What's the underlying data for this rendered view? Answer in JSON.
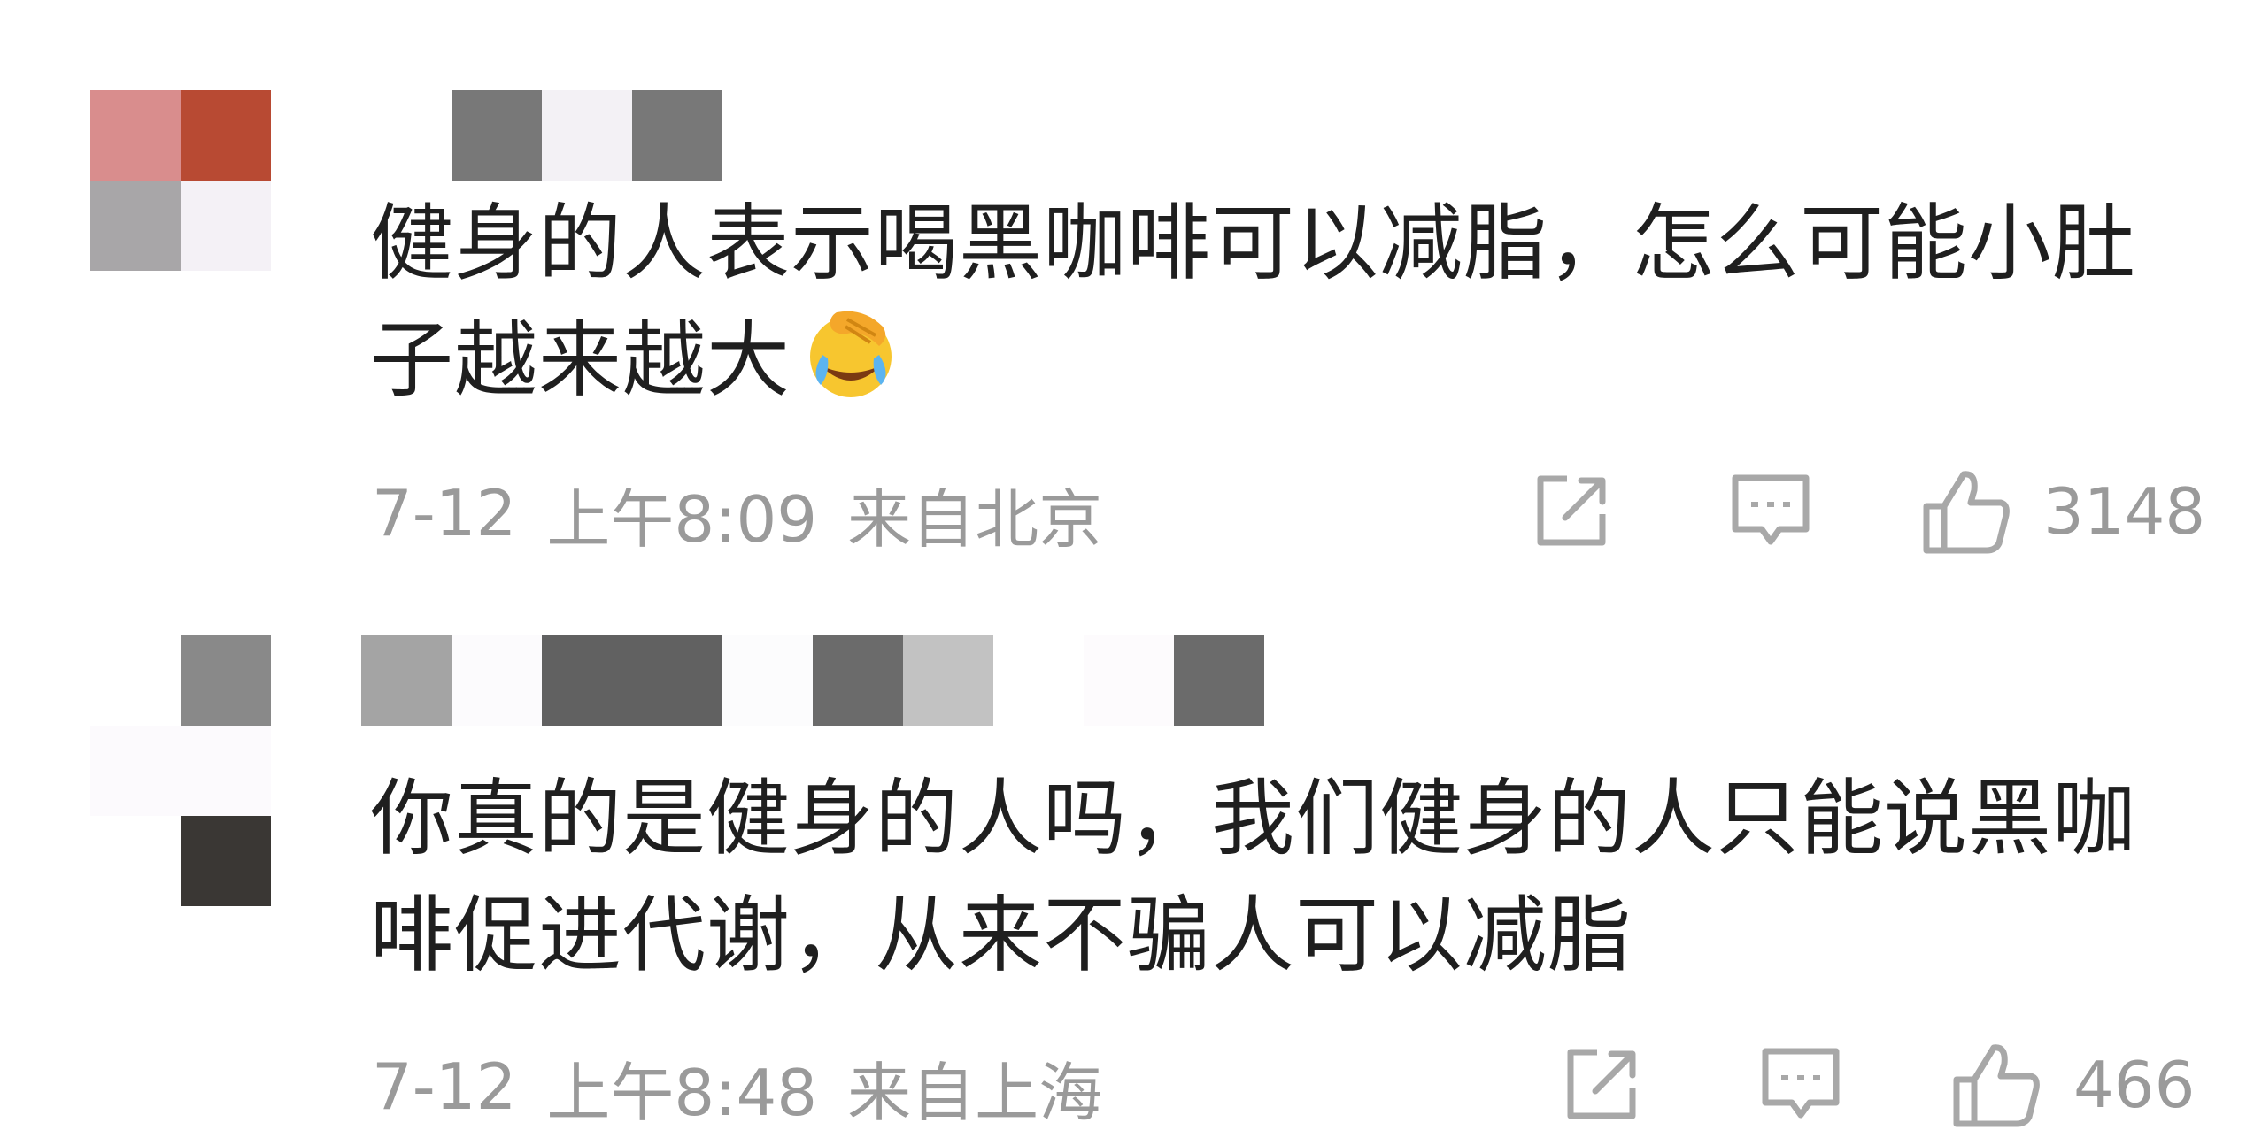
{
  "comments": [
    {
      "username_hidden": true,
      "avatar_colors": [
        "#d98d8d",
        "#b84a33",
        "#a8a6a8",
        "#f4f1f6"
      ],
      "username_blocks": [
        "#ffffff",
        "#ffffff",
        "#787878",
        "#f3f1f5",
        "#787878"
      ],
      "text": "健身的人表示喝黑咖啡可以减脂，怎么可能小肚子越来越大",
      "emoji": "face-palm-laughing-emoji",
      "date": "7-12",
      "time": "上午8:09",
      "location": "来自北京",
      "likes": "3148"
    },
    {
      "username_hidden": true,
      "avatar_colors": [
        "#ffffff",
        "#898989",
        "#fcfafd",
        "#3a3734"
      ],
      "username_blocks": [
        "#ffffff",
        "#a4a4a4",
        "#fcfbfd",
        "#616161",
        "#616161",
        "#fcfcfd",
        "#6b6b6b",
        "#c2c2c2",
        "#ffffff",
        "#fdfbfd",
        "#6b6b6b"
      ],
      "text": "你真的是健身的人吗，我们健身的人只能说黑咖啡促进代谢，从来不骗人可以减脂",
      "date": "7-12",
      "time": "上午8:48",
      "location": "来自上海",
      "likes": "466"
    }
  ],
  "icons": {
    "share": "share-icon",
    "reply": "comment-icon",
    "like": "thumbs-up-icon"
  },
  "colors": {
    "text": "#1f1f1f",
    "meta": "#9a9a9a",
    "background": "#ffffff"
  }
}
